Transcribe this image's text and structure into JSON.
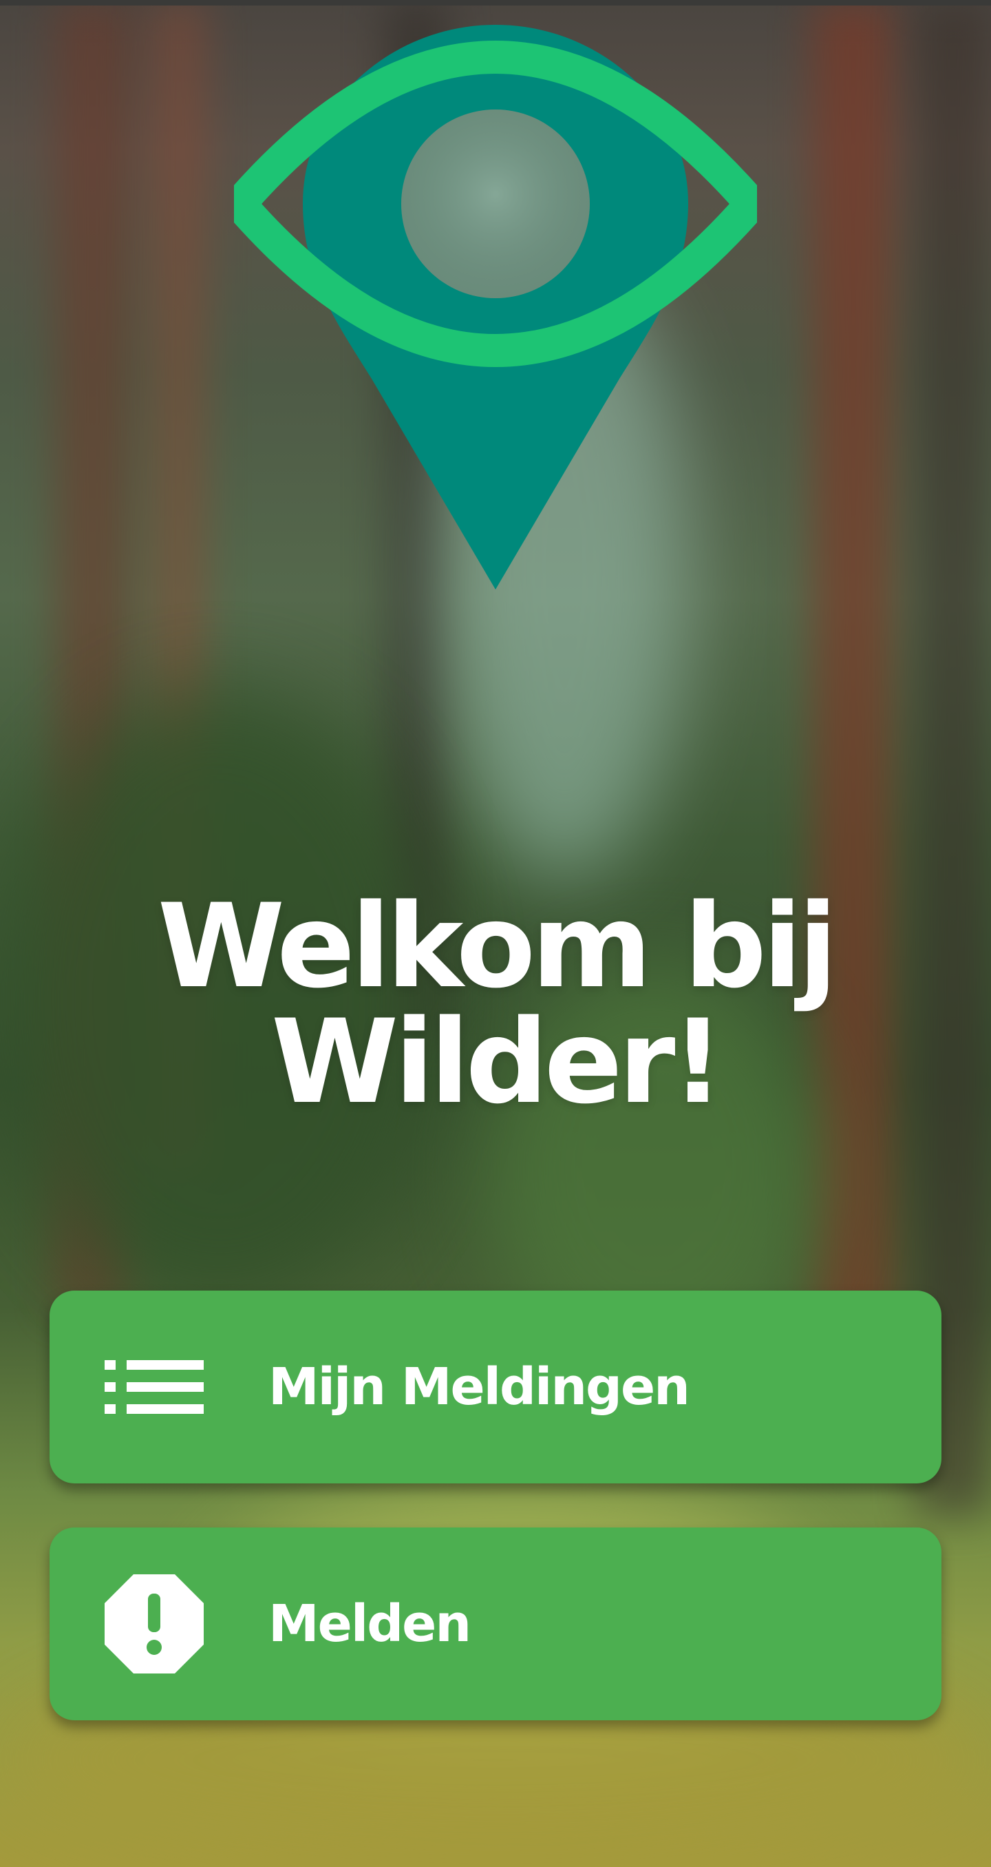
{
  "title": "Welkom bij Wilder!",
  "logo": {
    "icon": "eye-location-pin-icon",
    "colors": {
      "pin": "#00897b",
      "eye_outline": "#1dc474"
    }
  },
  "buttons": [
    {
      "label": "Mijn Meldingen",
      "icon": "list-icon"
    },
    {
      "label": "Melden",
      "icon": "alert-octagon-icon"
    }
  ],
  "colors": {
    "button_bg": "#4caf50",
    "text": "#ffffff"
  }
}
